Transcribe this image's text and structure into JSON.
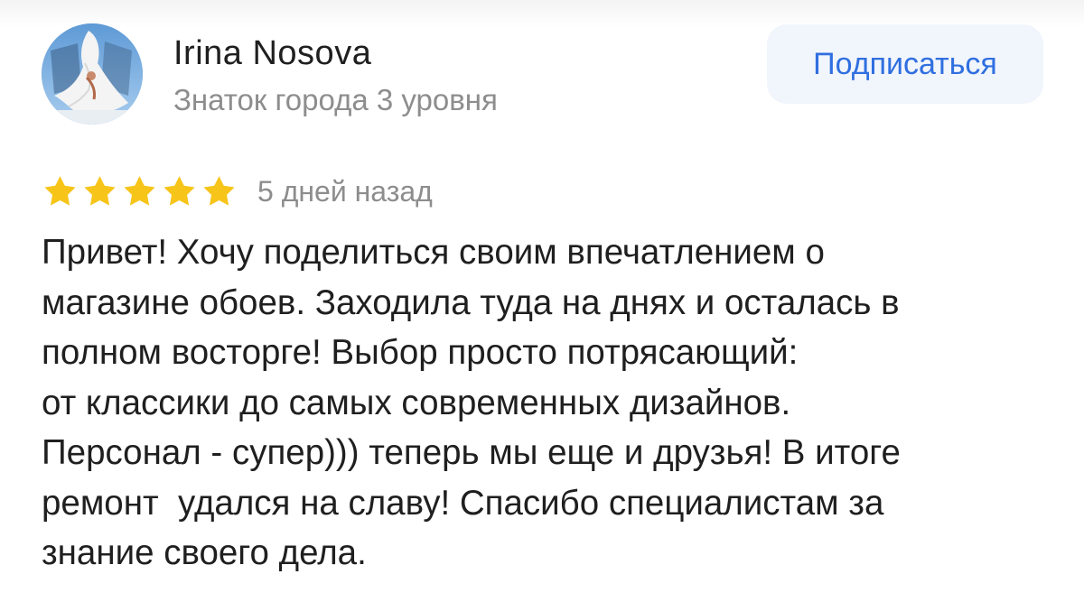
{
  "author": {
    "name": "Irina Nosova",
    "level": "Знаток города 3 уровня"
  },
  "subscribe_label": "Подписаться",
  "rating": {
    "value": 5,
    "max": 5,
    "star_color": "#f7c51a"
  },
  "review": {
    "date": "5 дней назад",
    "lines": [
      "Привет! Хочу поделиться своим впечатлением о",
      "магазине обоев. Заходила туда на днях и осталась в",
      "полном восторге! Выбор просто потрясающий:",
      "от классики до самых современных дизайнов.",
      "Персонал - супер))) теперь мы еще и друзья! В итоге",
      "ремонт  удался на славу! Спасибо специалистам за",
      "знание своего дела."
    ]
  },
  "colors": {
    "accent": "#2f6fe0",
    "secondary_text": "#8d8d8d",
    "button_bg": "#f1f5fc"
  },
  "icons": {
    "avatar": "user-avatar-photo",
    "star": "star-icon"
  }
}
